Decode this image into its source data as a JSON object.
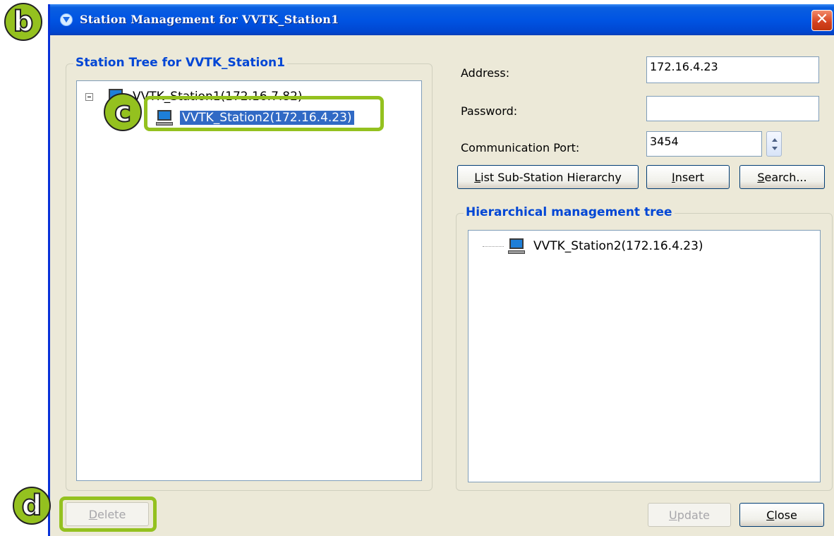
{
  "window": {
    "title": "Station Management for VVTK_Station1"
  },
  "station_tree": {
    "legend": "Station Tree for VVTK_Station1",
    "root": "VVTK_Station1(172.16.7.82)",
    "child": "VVTK_Station2(172.16.4.23)"
  },
  "form": {
    "address_label": "Address:",
    "address_value": "172.16.4.23",
    "password_label": "Password:",
    "password_value": "",
    "port_label": "Communication Port:",
    "port_value": "3454"
  },
  "buttons": {
    "list_prefix": "L",
    "list_rest": "ist Sub-Station Hierarchy",
    "insert_prefix": "I",
    "insert_rest": "nsert",
    "search_prefix": "S",
    "search_rest": "earch...",
    "delete_prefix": "D",
    "delete_rest": "elete",
    "update_prefix": "U",
    "update_rest": "pdate",
    "close_prefix": "C",
    "close_rest": "lose"
  },
  "hier_tree": {
    "legend": "Hierarchical management tree",
    "node": "VVTK_Station2(172.16.4.23)"
  },
  "callouts": {
    "b": "b",
    "c": "c",
    "d": "d"
  },
  "colors": {
    "callout": "#94c11f",
    "selection": "#316ac5",
    "legend": "#0046d5"
  }
}
